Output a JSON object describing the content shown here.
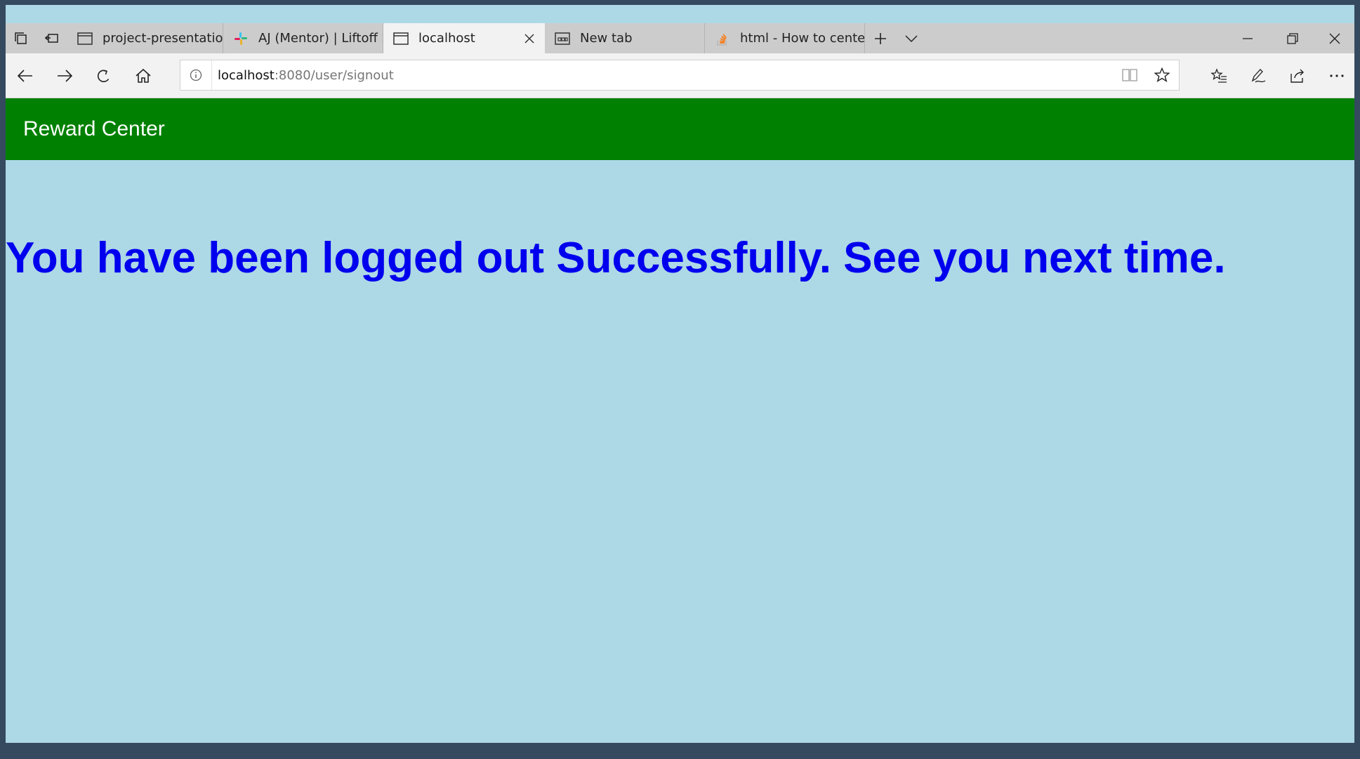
{
  "browser": {
    "tabs": [
      {
        "title": "project-presentation.pdf",
        "icon": "document-icon",
        "active": false
      },
      {
        "title": "AJ (Mentor) | Liftoff STL Jan",
        "icon": "slack-icon",
        "active": false
      },
      {
        "title": "localhost",
        "icon": "page-icon",
        "active": true
      },
      {
        "title": "New tab",
        "icon": "new-tab-icon",
        "active": false
      },
      {
        "title": "html - How to center conter",
        "icon": "stackoverflow-icon",
        "active": false
      }
    ],
    "address": {
      "host": "localhost",
      "path": ":8080/user/signout"
    }
  },
  "page": {
    "brand": "Reward Center",
    "message": "You have been logged out Successfully. See you next time."
  },
  "colors": {
    "header_bg": "#008000",
    "page_bg": "#add8e6",
    "message_text": "#0000ee",
    "chrome_bg": "#354a5f"
  }
}
